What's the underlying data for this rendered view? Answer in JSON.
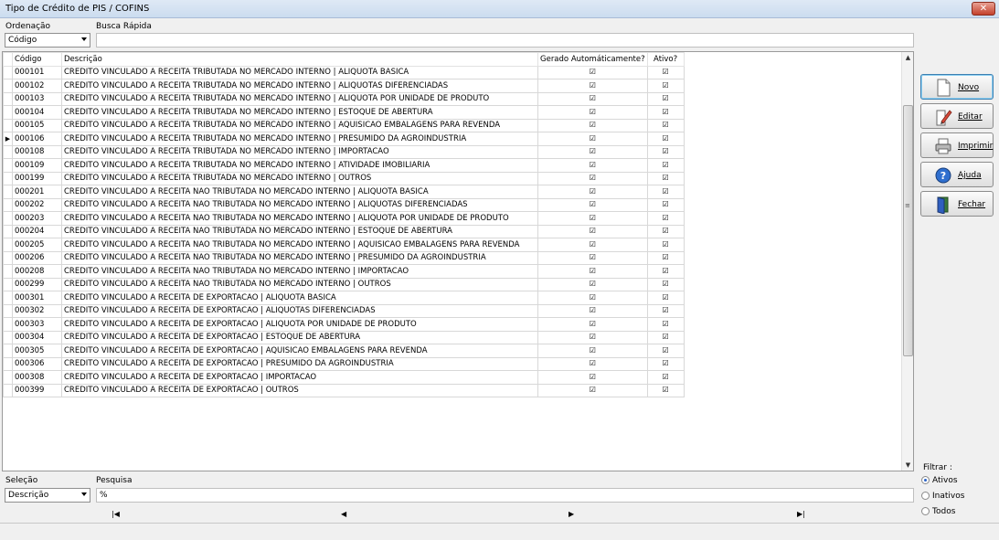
{
  "window": {
    "title": "Tipo de Crédito de PIS / COFINS",
    "close_glyph": "✕"
  },
  "top": {
    "ordenacao_label": "Ordenação",
    "ordenacao_value": "Código",
    "busca_label": "Busca Rápida",
    "busca_value": ""
  },
  "grid": {
    "headers": {
      "code": "Código",
      "desc": "Descrição",
      "gen": "Gerado Automáticamente?",
      "active": "Ativo?"
    },
    "current_row_indicator": "▶",
    "check_glyph": "☑",
    "rows": [
      {
        "code": "000101",
        "desc": "CREDITO VINCULADO A RECEITA TRIBUTADA NO MERCADO INTERNO | ALIQUOTA BASICA"
      },
      {
        "code": "000102",
        "desc": "CREDITO VINCULADO A RECEITA TRIBUTADA NO MERCADO INTERNO | ALIQUOTAS DIFERENCIADAS"
      },
      {
        "code": "000103",
        "desc": "CREDITO VINCULADO A RECEITA TRIBUTADA NO MERCADO INTERNO | ALIQUOTA POR UNIDADE DE PRODUTO"
      },
      {
        "code": "000104",
        "desc": "CREDITO VINCULADO A RECEITA TRIBUTADA NO MERCADO INTERNO | ESTOQUE DE ABERTURA"
      },
      {
        "code": "000105",
        "desc": "CREDITO VINCULADO A RECEITA TRIBUTADA NO MERCADO INTERNO | AQUISICAO EMBALAGENS PARA REVENDA"
      },
      {
        "code": "000106",
        "desc": "CREDITO VINCULADO A RECEITA TRIBUTADA NO MERCADO INTERNO | PRESUMIDO DA AGROINDUSTRIA",
        "current": true
      },
      {
        "code": "000108",
        "desc": "CREDITO VINCULADO A RECEITA TRIBUTADA NO MERCADO INTERNO | IMPORTACAO"
      },
      {
        "code": "000109",
        "desc": "CREDITO VINCULADO A RECEITA TRIBUTADA NO MERCADO INTERNO | ATIVIDADE IMOBILIARIA"
      },
      {
        "code": "000199",
        "desc": "CREDITO VINCULADO A RECEITA TRIBUTADA NO MERCADO INTERNO | OUTROS"
      },
      {
        "code": "000201",
        "desc": "CREDITO VINCULADO A RECEITA NAO TRIBUTADA NO MERCADO INTERNO | ALIQUOTA BASICA"
      },
      {
        "code": "000202",
        "desc": "CREDITO VINCULADO A RECEITA NAO TRIBUTADA NO MERCADO INTERNO | ALIQUOTAS DIFERENCIADAS"
      },
      {
        "code": "000203",
        "desc": "CREDITO VINCULADO A RECEITA NAO TRIBUTADA NO MERCADO INTERNO | ALIQUOTA POR UNIDADE DE PRODUTO"
      },
      {
        "code": "000204",
        "desc": "CREDITO VINCULADO A RECEITA NAO TRIBUTADA NO MERCADO INTERNO | ESTOQUE DE ABERTURA"
      },
      {
        "code": "000205",
        "desc": "CREDITO VINCULADO A RECEITA NAO TRIBUTADA NO MERCADO INTERNO | AQUISICAO EMBALAGENS PARA REVENDA"
      },
      {
        "code": "000206",
        "desc": "CREDITO VINCULADO A RECEITA NAO TRIBUTADA NO MERCADO INTERNO | PRESUMIDO DA AGROINDUSTRIA"
      },
      {
        "code": "000208",
        "desc": "CREDITO VINCULADO A RECEITA NAO TRIBUTADA NO MERCADO INTERNO | IMPORTACAO"
      },
      {
        "code": "000299",
        "desc": "CREDITO VINCULADO A RECEITA NAO TRIBUTADA NO MERCADO INTERNO | OUTROS"
      },
      {
        "code": "000301",
        "desc": "CREDITO VINCULADO A RECEITA DE EXPORTACAO | ALIQUOTA BASICA"
      },
      {
        "code": "000302",
        "desc": "CREDITO VINCULADO A RECEITA DE EXPORTACAO | ALIQUOTAS DIFERENCIADAS"
      },
      {
        "code": "000303",
        "desc": "CREDITO VINCULADO A RECEITA DE EXPORTACAO | ALIQUOTA POR UNIDADE DE PRODUTO"
      },
      {
        "code": "000304",
        "desc": "CREDITO VINCULADO A RECEITA DE EXPORTACAO | ESTOQUE DE ABERTURA"
      },
      {
        "code": "000305",
        "desc": "CREDITO VINCULADO A RECEITA DE EXPORTACAO | AQUISICAO EMBALAGENS PARA REVENDA"
      },
      {
        "code": "000306",
        "desc": "CREDITO VINCULADO A RECEITA DE EXPORTACAO | PRESUMIDO DA AGROINDUSTRIA"
      },
      {
        "code": "000308",
        "desc": "CREDITO VINCULADO A RECEITA DE EXPORTACAO | IMPORTACAO"
      },
      {
        "code": "000399",
        "desc": "CREDITO VINCULADO A RECEITA DE EXPORTACAO | OUTROS"
      }
    ]
  },
  "scrollbar": {
    "up": "▲",
    "down": "▼",
    "grip": "≡"
  },
  "buttons": {
    "novo": "Novo",
    "editar": "Editar",
    "imprimir": "Imprimir",
    "ajuda": "Ajuda",
    "fechar": "Fechar"
  },
  "bottom": {
    "selecao_label": "Seleção",
    "selecao_value": "Descrição",
    "pesquisa_label": "Pesquisa",
    "pesquisa_value": "%"
  },
  "nav": {
    "first": "|◀",
    "prev": "◀",
    "next": "▶",
    "last": "▶|"
  },
  "filter": {
    "label": "Filtrar :",
    "options": [
      {
        "label": "Ativos",
        "selected": true
      },
      {
        "label": "Inativos",
        "selected": false
      },
      {
        "label": "Todos",
        "selected": false
      }
    ]
  },
  "colors": {
    "accent": "#2a63c7",
    "close": "#c4412c"
  }
}
